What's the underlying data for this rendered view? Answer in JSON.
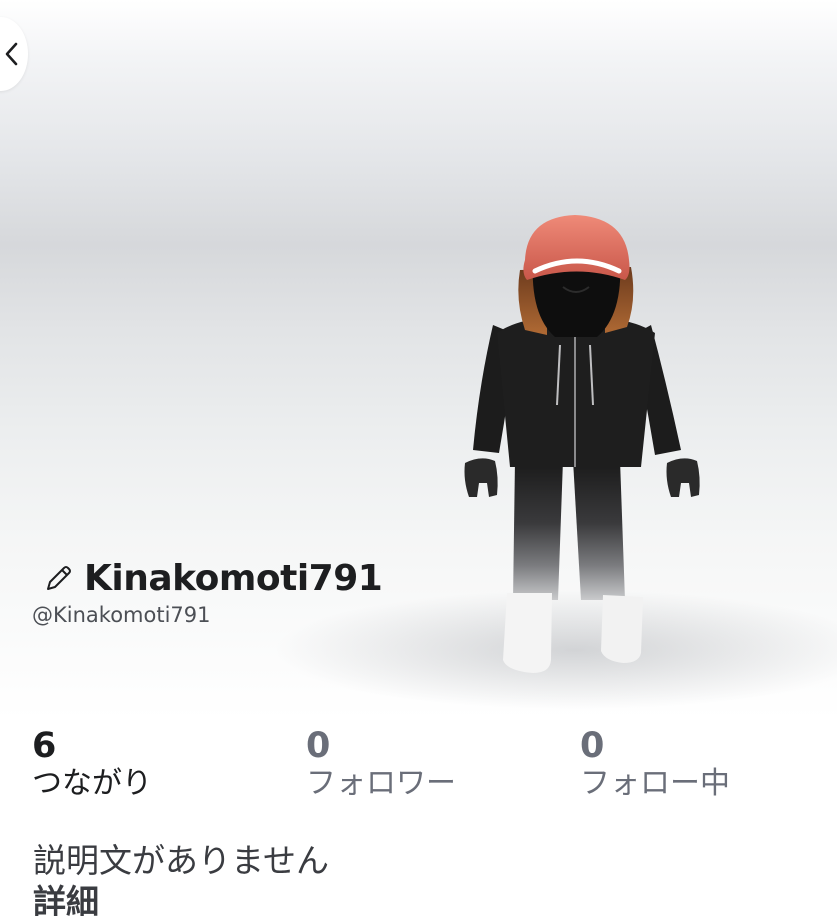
{
  "profile": {
    "display_name": "Kinakomoti791",
    "username": "@Kinakomoti791",
    "description": "説明文がありません",
    "details_label": "詳細"
  },
  "stats": {
    "connections": {
      "value": "6",
      "label": "つながり"
    },
    "followers": {
      "value": "0",
      "label": "フォロワー"
    },
    "following": {
      "value": "0",
      "label": "フォロー中"
    }
  },
  "icons": {
    "back": "chevron-left-icon",
    "edit": "pencil-icon"
  },
  "colors": {
    "primary_text": "#1d1e20",
    "secondary_text": "#6a6e79",
    "hat": "#e07060"
  }
}
